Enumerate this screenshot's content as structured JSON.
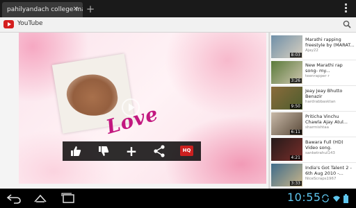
{
  "browser": {
    "tab_title": "pahilyandach college ma...",
    "close_glyph": "✕",
    "newtab_glyph": "+"
  },
  "header": {
    "title": "YouTube",
    "accent": "#d41e1e"
  },
  "player": {
    "overlay_text": "Love",
    "controls": {
      "like_icon": "thumbs-up-icon",
      "dislike_icon": "thumbs-down-icon",
      "add_glyph": "+",
      "share_icon": "share-icon",
      "hq_label": "HQ"
    }
  },
  "related": [
    {
      "title": "Marathi rapping freestyle by (MARAT...",
      "channel": "Ajay22",
      "duration": "8:03",
      "thumb": [
        "#6f8fa8",
        "#d9d0c0"
      ]
    },
    {
      "title": "New Marathi rap song- my...",
      "channel": "teenrapper r",
      "duration": "3:26",
      "thumb": [
        "#5a7a3a",
        "#cfc6b0"
      ]
    },
    {
      "title": "Jeay Jeay Bhutto Benazir",
      "channel": "hardrabbasktan",
      "duration": "9:50",
      "thumb": [
        "#8a6b3b",
        "#4d5d2e"
      ]
    },
    {
      "title": "Priticha Vinchu Chawla Ajay Atul...",
      "channel": "sharmishtaa",
      "duration": "6:11",
      "thumb": [
        "#c8b9a8",
        "#5a4a3a"
      ]
    },
    {
      "title": "Bawara Full (HD) Video song.",
      "channel": "sanketrahul143",
      "duration": "4:21",
      "thumb": [
        "#241a1a",
        "#7a2e2a"
      ]
    },
    {
      "title": "India's Got Talent 2 - 6th Aug 2010 -...",
      "channel": "NiceScraps1967",
      "duration": "3:33",
      "thumb": [
        "#3e6b8a",
        "#c9b58a"
      ]
    }
  ],
  "status": {
    "time": "10:55"
  }
}
